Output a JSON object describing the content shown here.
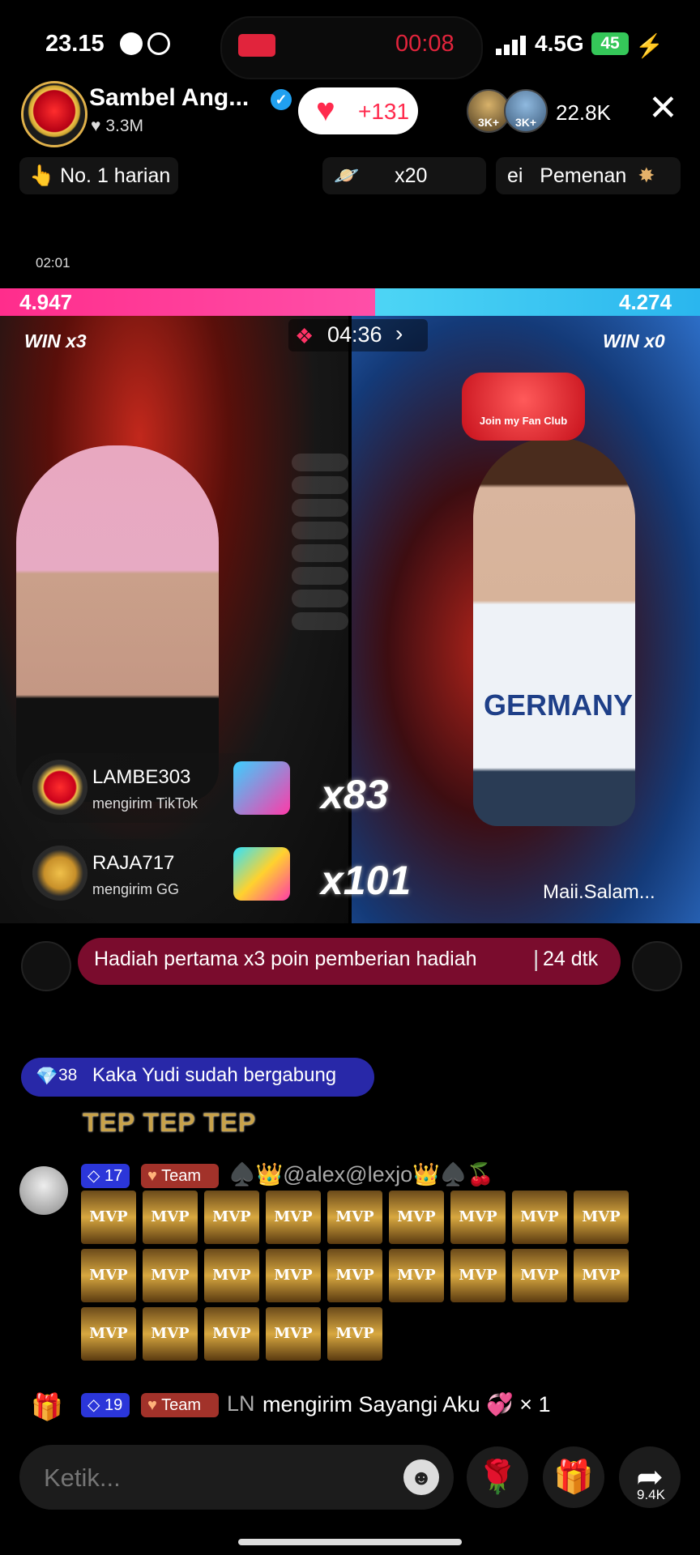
{
  "status_bar": {
    "time": "23.15",
    "recording_time": "00:08",
    "network": "4.5G",
    "battery": "45"
  },
  "header": {
    "host_name": "Sambel Ang...",
    "host_likes": "3.3M",
    "like_count": "+131",
    "viewers": [
      "3K+",
      "3K+"
    ],
    "viewer_count": "22.8K"
  },
  "badges": {
    "rank": "No. 1 harian",
    "gift_multiplier": "x20",
    "winner_label": "ei   Pemenan"
  },
  "battle": {
    "sub_timer": "02:01",
    "score_left": "4.947",
    "score_right": "4.274",
    "score_left_fraction": 0.536,
    "win_left": "WIN x3",
    "win_right": "WIN x0",
    "round_time": "04:36",
    "fanclub": "Join my Fan Club",
    "jersey_text": "GERMANY",
    "right_name": "Maii.Salam..."
  },
  "gifts": [
    {
      "user": "LAMBE303",
      "action": "mengirim TikTok",
      "combo": "x83"
    },
    {
      "user": "RAJA717",
      "action": "mengirim GG",
      "combo": "x101"
    }
  ],
  "banner": {
    "text": "Hadiah pertama x3 poin pemberian hadiah",
    "time": "24 dtk"
  },
  "chat": {
    "join": {
      "level": "38",
      "text": "Kaka Yudi sudah bergabung"
    },
    "tep": "TEP TEP TEP",
    "message": {
      "level": "17",
      "team": "Team",
      "user": "♠️👑@alex@lexjo👑♠️🍒",
      "mvp_label": "MVP",
      "mvp_count": 23
    },
    "gift_message": {
      "level": "19",
      "team": "Team",
      "user": "LN",
      "text": "mengirim Sayangi Aku 💞 × 1"
    }
  },
  "bottom": {
    "input_placeholder": "Ketik...",
    "share_count": "9.4K"
  },
  "colors": {
    "pink": "#ff2d8c",
    "blue": "#2ab6ee",
    "banner": "#7a0c2d",
    "join": "#2828a8"
  }
}
